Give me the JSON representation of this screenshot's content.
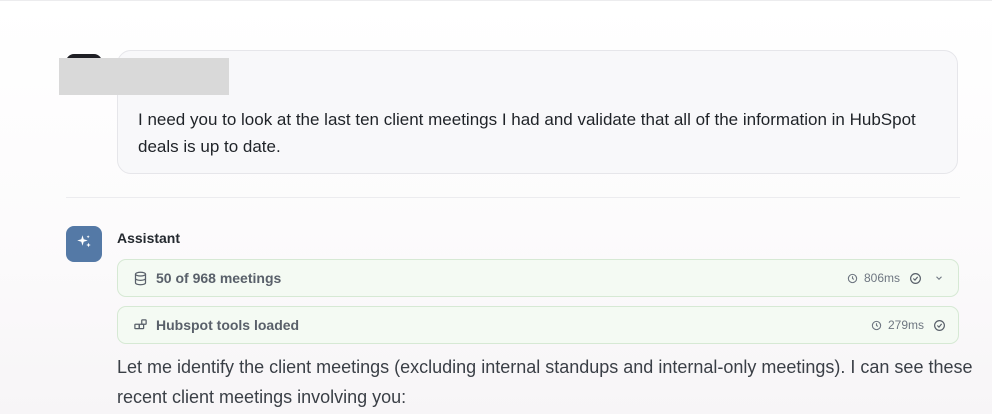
{
  "user_message": {
    "text": "I need you to look at the last ten client meetings I had and validate that all of the information in HubSpot deals is up to date."
  },
  "assistant": {
    "name": "Assistant",
    "avatar_icon": "sparkles-icon",
    "tool_calls": [
      {
        "icon": "database-icon",
        "label": "50 of 968 meetings",
        "duration": "806ms",
        "status": "success",
        "expandable": true
      },
      {
        "icon": "blocks-icon",
        "label": "Hubspot tools loaded",
        "duration": "279ms",
        "status": "success",
        "expandable": false
      }
    ],
    "text": "Let me identify the client meetings (excluding internal standups and internal-only meetings). I can see these recent client meetings involving you:"
  },
  "colors": {
    "assistant_avatar": "#5479a6",
    "tool_card_bg": "#f4faf3",
    "tool_card_border": "#d6e9d4",
    "redaction": "#d9d9d9"
  }
}
